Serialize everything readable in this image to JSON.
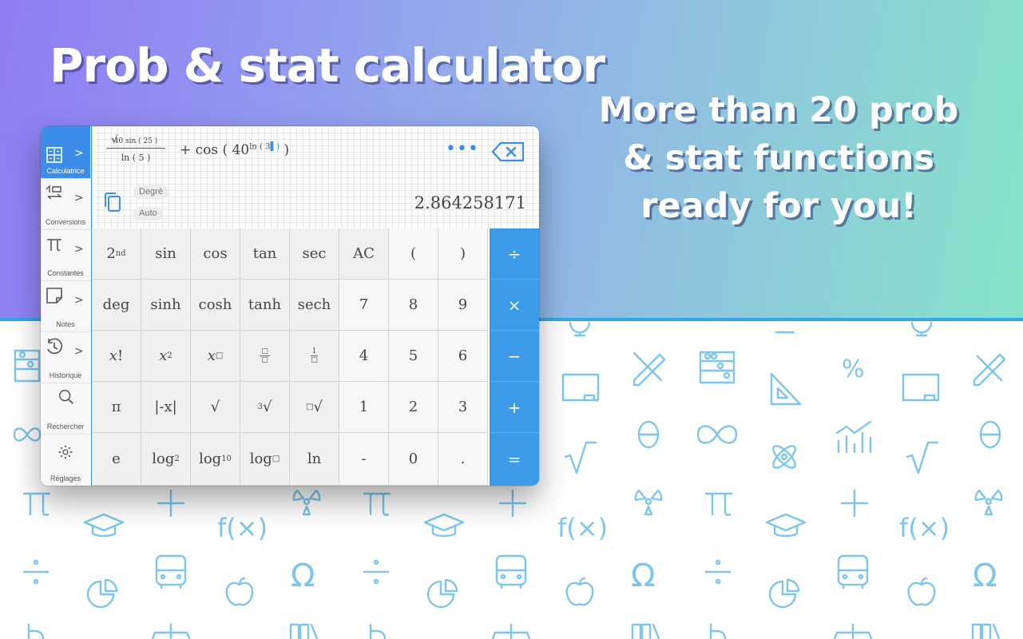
{
  "hero": {
    "title": "Prob & stat calculator",
    "tagline": [
      "More than 20 prob",
      "& stat functions",
      "ready for you!"
    ]
  },
  "colors": {
    "accent": "#3b8de8",
    "operator_key": "#3b9bea",
    "pattern": "#7cc6ee"
  },
  "window": {
    "traffic_lights": [
      "#fe5f57",
      "#febc2e",
      "#28c840"
    ],
    "sidebar": [
      {
        "label": "Calculatrice",
        "icon": "calculator-icon",
        "active": true
      },
      {
        "label": "Conversions",
        "icon": "conversion-icon",
        "active": false
      },
      {
        "label": "Constantes",
        "icon": "pi-icon",
        "active": false
      },
      {
        "label": "Notes",
        "icon": "note-icon",
        "active": false
      },
      {
        "label": "Historique",
        "icon": "history-icon",
        "active": false
      },
      {
        "label": "Rechercher",
        "icon": "search-icon",
        "active": false
      },
      {
        "label": "Réglages",
        "icon": "gear-icon",
        "active": false
      }
    ],
    "display": {
      "expression": {
        "numerator": "40 sin ( 25 )",
        "denominator": "ln ( 5 )",
        "rest": "+ cos ( 40",
        "rest_sup": "ln ( 3",
        "rest_close": ")"
      },
      "angle_mode": "Degré",
      "format_mode": "Auto",
      "result": "2.864258171"
    },
    "keypad": {
      "row1": [
        "2nd",
        "sin",
        "cos",
        "tan",
        "sec",
        "AC",
        "(",
        ")",
        "÷"
      ],
      "row2": [
        "deg",
        "sinh",
        "cosh",
        "tanh",
        "sech",
        "7",
        "8",
        "9",
        "×"
      ],
      "row3": [
        "x!",
        "x²",
        "x□",
        "□/□",
        "1/□",
        "4",
        "5",
        "6",
        "−"
      ],
      "row4": [
        "π",
        "|-x|",
        "√",
        "³√",
        "□√",
        "1",
        "2",
        "3",
        "+"
      ],
      "row5": [
        "e",
        "log₂",
        "log₁₀",
        "log□",
        "ln",
        "-",
        "0",
        ".",
        "="
      ],
      "labels": {
        "second": "2",
        "second_sup": "nd",
        "x": "x",
        "sq_sup": "2",
        "box": "□",
        "one": "1",
        "log": "log",
        "log2_sub": "2",
        "log10_sub": "10",
        "cbrt_idx": "3"
      }
    }
  }
}
